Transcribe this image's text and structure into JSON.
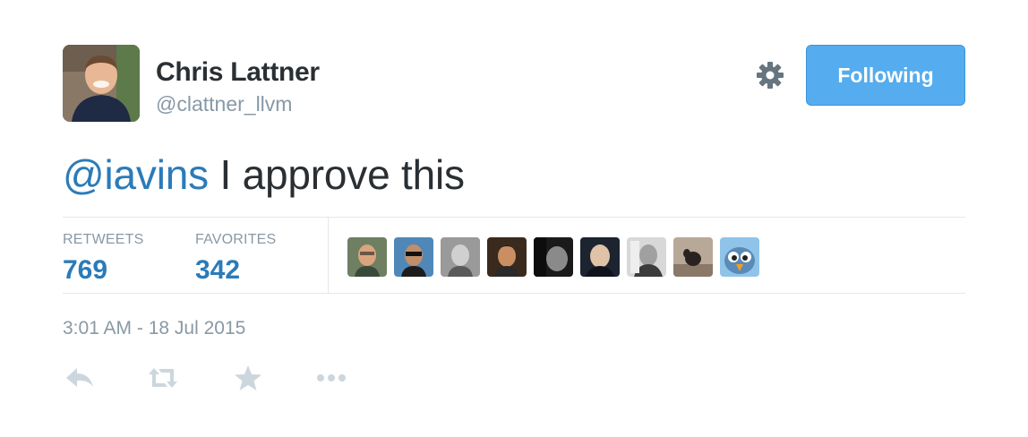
{
  "user": {
    "name": "Chris Lattner",
    "handle": "@clattner_llvm"
  },
  "follow_button": {
    "label": "Following"
  },
  "tweet": {
    "mention": "@iavins",
    "text": " I approve this"
  },
  "stats": {
    "retweets_label": "RETWEETS",
    "retweets_count": "769",
    "favorites_label": "FAVORITES",
    "favorites_count": "342"
  },
  "timestamp": "3:01 AM - 18 Jul 2015",
  "icons": {
    "settings": "gear-icon",
    "reply": "reply-icon",
    "retweet": "retweet-icon",
    "favorite": "star-icon",
    "more": "more-icon"
  },
  "colors": {
    "accent": "#55acee",
    "link": "#2b7bb9",
    "muted": "#8899a6",
    "text": "#292f33",
    "action_icons": "#ccd6dd"
  }
}
